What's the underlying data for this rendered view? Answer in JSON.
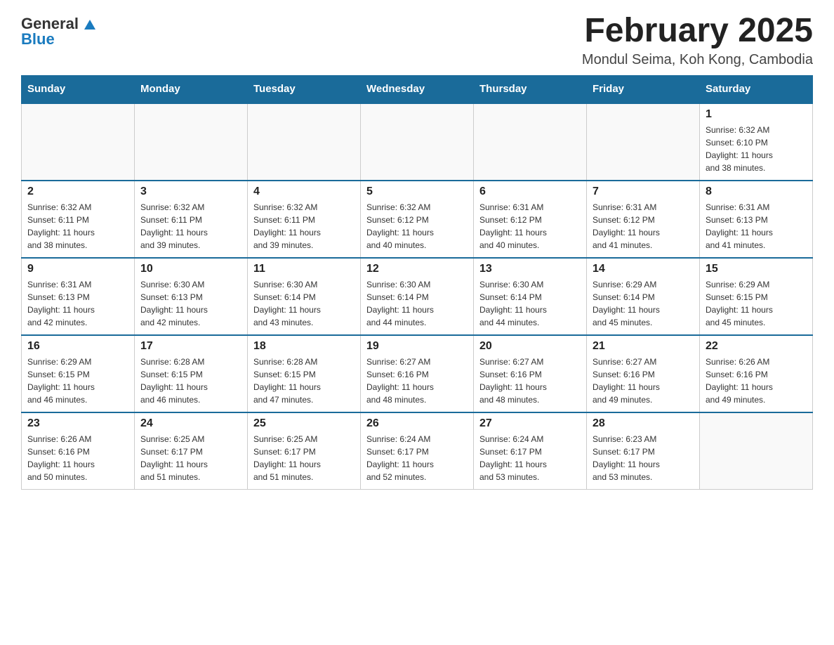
{
  "header": {
    "logo_general": "General",
    "logo_blue": "Blue",
    "month_title": "February 2025",
    "location": "Mondul Seima, Koh Kong, Cambodia"
  },
  "weekdays": [
    "Sunday",
    "Monday",
    "Tuesday",
    "Wednesday",
    "Thursday",
    "Friday",
    "Saturday"
  ],
  "weeks": [
    [
      {
        "day": "",
        "info": ""
      },
      {
        "day": "",
        "info": ""
      },
      {
        "day": "",
        "info": ""
      },
      {
        "day": "",
        "info": ""
      },
      {
        "day": "",
        "info": ""
      },
      {
        "day": "",
        "info": ""
      },
      {
        "day": "1",
        "info": "Sunrise: 6:32 AM\nSunset: 6:10 PM\nDaylight: 11 hours\nand 38 minutes."
      }
    ],
    [
      {
        "day": "2",
        "info": "Sunrise: 6:32 AM\nSunset: 6:11 PM\nDaylight: 11 hours\nand 38 minutes."
      },
      {
        "day": "3",
        "info": "Sunrise: 6:32 AM\nSunset: 6:11 PM\nDaylight: 11 hours\nand 39 minutes."
      },
      {
        "day": "4",
        "info": "Sunrise: 6:32 AM\nSunset: 6:11 PM\nDaylight: 11 hours\nand 39 minutes."
      },
      {
        "day": "5",
        "info": "Sunrise: 6:32 AM\nSunset: 6:12 PM\nDaylight: 11 hours\nand 40 minutes."
      },
      {
        "day": "6",
        "info": "Sunrise: 6:31 AM\nSunset: 6:12 PM\nDaylight: 11 hours\nand 40 minutes."
      },
      {
        "day": "7",
        "info": "Sunrise: 6:31 AM\nSunset: 6:12 PM\nDaylight: 11 hours\nand 41 minutes."
      },
      {
        "day": "8",
        "info": "Sunrise: 6:31 AM\nSunset: 6:13 PM\nDaylight: 11 hours\nand 41 minutes."
      }
    ],
    [
      {
        "day": "9",
        "info": "Sunrise: 6:31 AM\nSunset: 6:13 PM\nDaylight: 11 hours\nand 42 minutes."
      },
      {
        "day": "10",
        "info": "Sunrise: 6:30 AM\nSunset: 6:13 PM\nDaylight: 11 hours\nand 42 minutes."
      },
      {
        "day": "11",
        "info": "Sunrise: 6:30 AM\nSunset: 6:14 PM\nDaylight: 11 hours\nand 43 minutes."
      },
      {
        "day": "12",
        "info": "Sunrise: 6:30 AM\nSunset: 6:14 PM\nDaylight: 11 hours\nand 44 minutes."
      },
      {
        "day": "13",
        "info": "Sunrise: 6:30 AM\nSunset: 6:14 PM\nDaylight: 11 hours\nand 44 minutes."
      },
      {
        "day": "14",
        "info": "Sunrise: 6:29 AM\nSunset: 6:14 PM\nDaylight: 11 hours\nand 45 minutes."
      },
      {
        "day": "15",
        "info": "Sunrise: 6:29 AM\nSunset: 6:15 PM\nDaylight: 11 hours\nand 45 minutes."
      }
    ],
    [
      {
        "day": "16",
        "info": "Sunrise: 6:29 AM\nSunset: 6:15 PM\nDaylight: 11 hours\nand 46 minutes."
      },
      {
        "day": "17",
        "info": "Sunrise: 6:28 AM\nSunset: 6:15 PM\nDaylight: 11 hours\nand 46 minutes."
      },
      {
        "day": "18",
        "info": "Sunrise: 6:28 AM\nSunset: 6:15 PM\nDaylight: 11 hours\nand 47 minutes."
      },
      {
        "day": "19",
        "info": "Sunrise: 6:27 AM\nSunset: 6:16 PM\nDaylight: 11 hours\nand 48 minutes."
      },
      {
        "day": "20",
        "info": "Sunrise: 6:27 AM\nSunset: 6:16 PM\nDaylight: 11 hours\nand 48 minutes."
      },
      {
        "day": "21",
        "info": "Sunrise: 6:27 AM\nSunset: 6:16 PM\nDaylight: 11 hours\nand 49 minutes."
      },
      {
        "day": "22",
        "info": "Sunrise: 6:26 AM\nSunset: 6:16 PM\nDaylight: 11 hours\nand 49 minutes."
      }
    ],
    [
      {
        "day": "23",
        "info": "Sunrise: 6:26 AM\nSunset: 6:16 PM\nDaylight: 11 hours\nand 50 minutes."
      },
      {
        "day": "24",
        "info": "Sunrise: 6:25 AM\nSunset: 6:17 PM\nDaylight: 11 hours\nand 51 minutes."
      },
      {
        "day": "25",
        "info": "Sunrise: 6:25 AM\nSunset: 6:17 PM\nDaylight: 11 hours\nand 51 minutes."
      },
      {
        "day": "26",
        "info": "Sunrise: 6:24 AM\nSunset: 6:17 PM\nDaylight: 11 hours\nand 52 minutes."
      },
      {
        "day": "27",
        "info": "Sunrise: 6:24 AM\nSunset: 6:17 PM\nDaylight: 11 hours\nand 53 minutes."
      },
      {
        "day": "28",
        "info": "Sunrise: 6:23 AM\nSunset: 6:17 PM\nDaylight: 11 hours\nand 53 minutes."
      },
      {
        "day": "",
        "info": ""
      }
    ]
  ]
}
